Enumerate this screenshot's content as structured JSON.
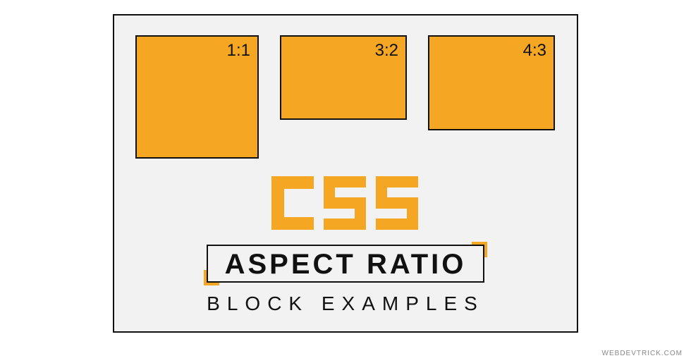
{
  "boxes": [
    {
      "label": "1:1"
    },
    {
      "label": "3:2"
    },
    {
      "label": "4:3"
    }
  ],
  "logo_text": "CSS",
  "heading": "ASPECT RATIO",
  "subheading": "BLOCK EXAMPLES",
  "watermark": "WEBDEVTRICK.COM",
  "colors": {
    "accent": "#f5a623",
    "border": "#111111",
    "bg": "#f2f2f2"
  }
}
